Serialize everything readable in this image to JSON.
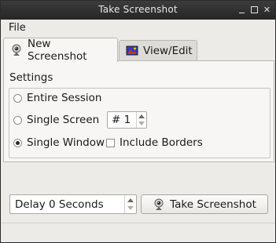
{
  "window": {
    "title": "Take Screenshot"
  },
  "menubar": {
    "file_label": "File"
  },
  "tabs": [
    {
      "label": "New Screenshot",
      "icon": "webcam-icon",
      "active": true
    },
    {
      "label": "View/Edit",
      "icon": "image-icon",
      "active": false
    }
  ],
  "settings": {
    "section_label": "Settings",
    "options": [
      {
        "label": "Entire Session",
        "checked": false
      },
      {
        "label": "Single Screen",
        "checked": false
      },
      {
        "label": "Single Window",
        "checked": true
      }
    ],
    "screen_number": "# 1",
    "include_borders_label": "Include Borders",
    "include_borders_checked": false
  },
  "footer": {
    "delay_value": "Delay 0 Seconds",
    "take_screenshot_label": "Take Screenshot"
  }
}
